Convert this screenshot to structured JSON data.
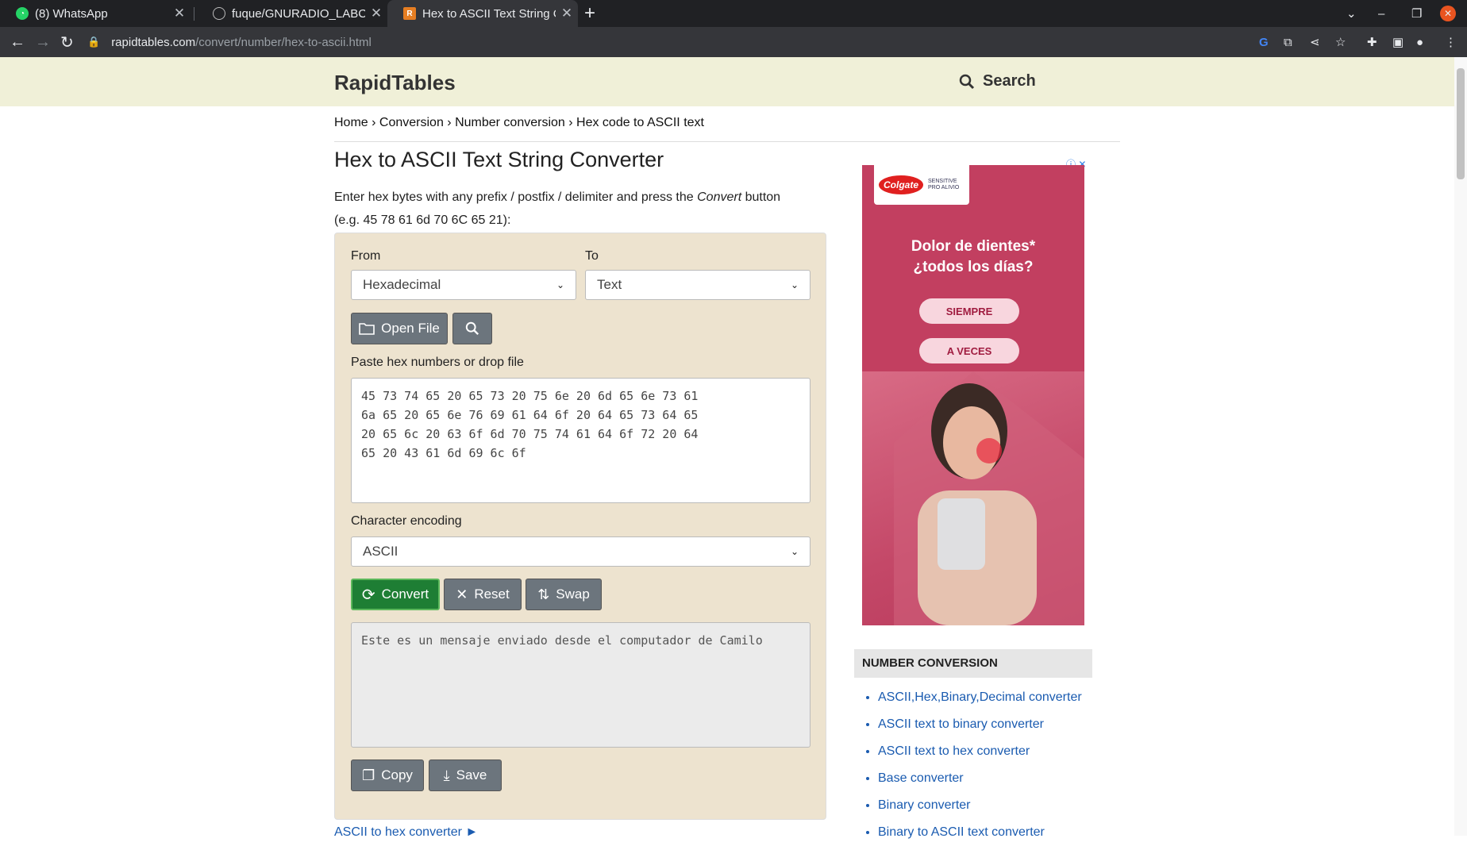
{
  "browser": {
    "tabs": [
      {
        "title": "(8) WhatsApp",
        "icon": "whatsapp-icon"
      },
      {
        "title": "fuque/GNURADIO_LABCO",
        "icon": "github-icon"
      },
      {
        "title": "Hex to ASCII Text String C",
        "icon": "rapidtables-icon"
      }
    ],
    "url_host": "rapidtables.com",
    "url_path": "/convert/number/hex-to-ascii.html"
  },
  "site": {
    "logo": "RapidTables",
    "search_label": "Search"
  },
  "breadcrumb": [
    "Home",
    "Conversion",
    "Number conversion",
    "Hex code to ASCII text"
  ],
  "page": {
    "title": "Hex to ASCII Text String Converter",
    "intro_a": "Enter hex bytes with any prefix / postfix / delimiter and press the ",
    "intro_em": "Convert",
    "intro_b": " button",
    "intro_example": "(e.g. 45 78 61 6d 70 6C 65 21):"
  },
  "converter": {
    "from_label": "From",
    "from_value": "Hexadecimal",
    "to_label": "To",
    "to_value": "Text",
    "open_file": "Open File",
    "input_label": "Paste hex numbers or drop file",
    "input_value": "45 73 74 65 20 65 73 20 75 6e 20 6d 65 6e 73 61\n6a 65 20 65 6e 76 69 61 64 6f 20 64 65 73 64 65\n20 65 6c 20 63 6f 6d 70 75 74 61 64 6f 72 20 64\n65 20 43 61 6d 69 6c 6f",
    "encoding_label": "Character encoding",
    "encoding_value": "ASCII",
    "convert": "Convert",
    "reset": "Reset",
    "swap": "Swap",
    "output_value": "Este es un mensaje enviado desde el computador de Camilo",
    "copy": "Copy",
    "save": "Save"
  },
  "ad": {
    "brand": "Colgate",
    "brand_sub": "SENSITIVE PRO ALIVIO",
    "headline_1": "Dolor de dientes*",
    "headline_2": "¿todos los días?",
    "option_1": "SIEMPRE",
    "option_2": "A VECES"
  },
  "sidebar": {
    "heading": "NUMBER CONVERSION",
    "links": [
      "ASCII,Hex,Binary,Decimal converter",
      "ASCII text to binary converter",
      "ASCII text to hex converter",
      "Base converter",
      "Binary converter",
      "Binary to ASCII text converter"
    ]
  },
  "bottom_link": "ASCII to hex converter ►",
  "colors": {
    "header_bg": "#f0f0d8",
    "panel_bg": "#ede3cf",
    "convert_btn": "#1e7e34",
    "link": "#1a5bb0"
  }
}
